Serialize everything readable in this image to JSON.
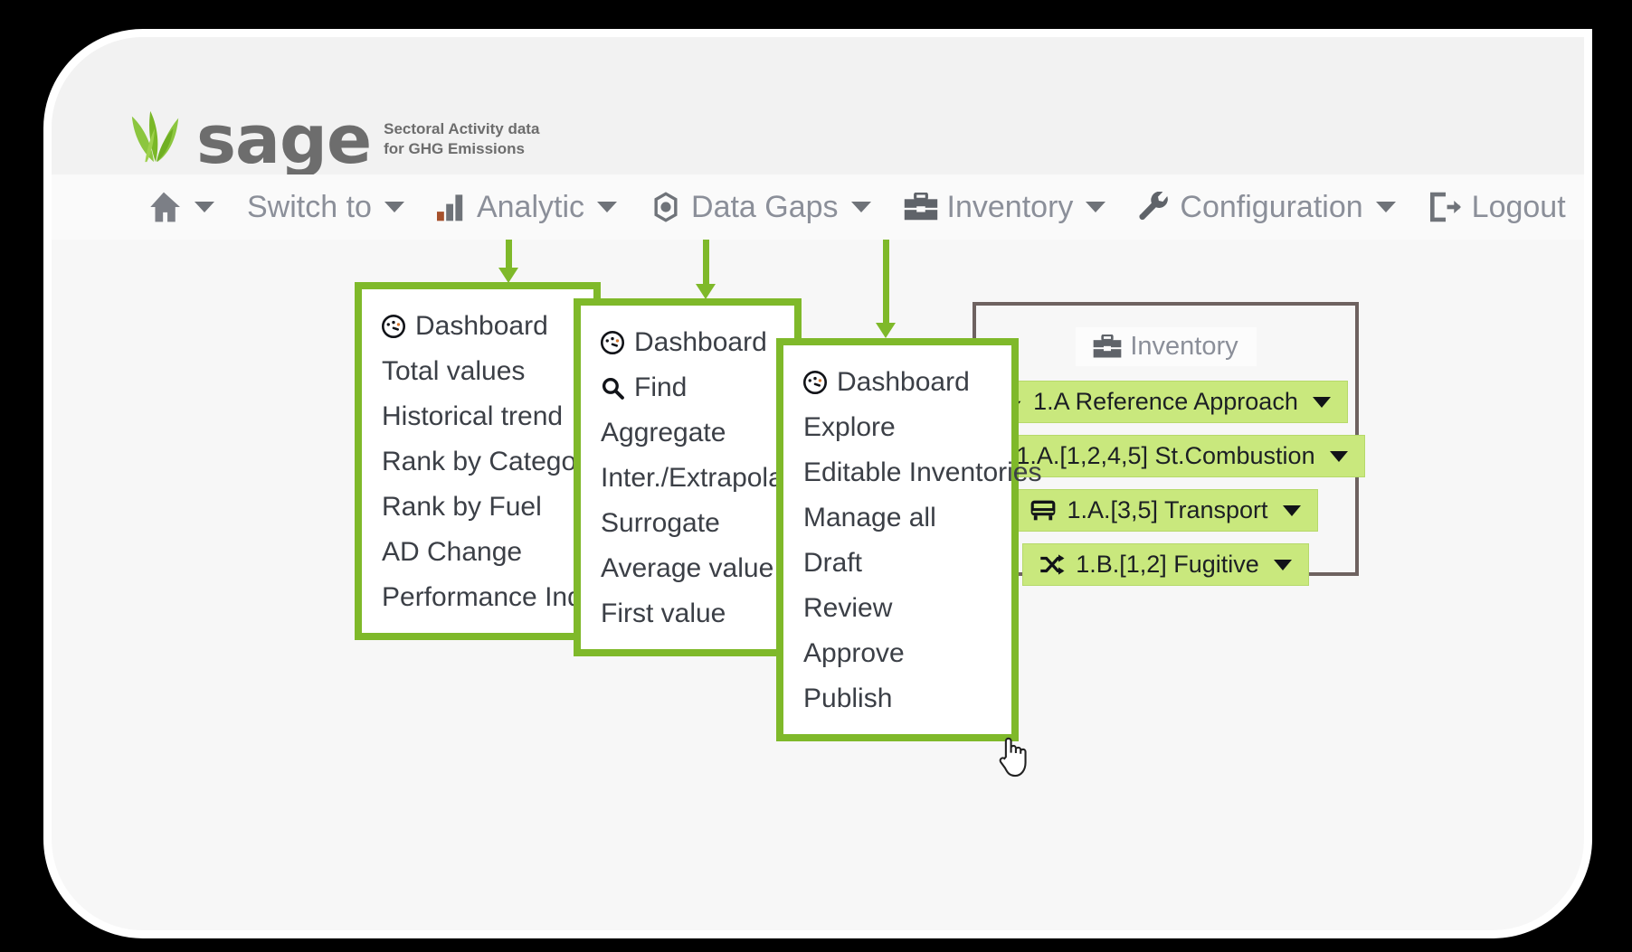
{
  "brand": {
    "wordmark": "sage",
    "tagline_line1": "Sectoral Activity data",
    "tagline_line2": "for GHG Emissions",
    "leaf_icon": "leaf-icon"
  },
  "colors": {
    "menu_border_green": "#7fb92a",
    "button_green": "#c9e87d",
    "panel_border_gray": "#6e6260",
    "nav_text_gray": "#8b8f99",
    "page_background": "#000000",
    "card_background": "#f7f7f7"
  },
  "navbar": {
    "items": [
      {
        "label": "",
        "icon": "home-icon",
        "caret": true
      },
      {
        "label": "Switch to",
        "icon": "",
        "caret": true
      },
      {
        "label": "Analytic",
        "icon": "bar-chart-icon",
        "caret": true
      },
      {
        "label": "Data Gaps",
        "icon": "eye-icon",
        "caret": true
      },
      {
        "label": "Inventory",
        "icon": "briefcase-icon",
        "caret": true
      },
      {
        "label": "Configuration",
        "icon": "wrench-icon",
        "caret": true
      },
      {
        "label": "Logout",
        "icon": "logout-icon",
        "caret": false
      }
    ]
  },
  "menus": {
    "analytic": {
      "source_nav": "Analytic",
      "items": [
        {
          "label": "Dashboard",
          "icon": "gauge-icon"
        },
        {
          "label": "Total values",
          "icon": ""
        },
        {
          "label": "Historical trend",
          "icon": ""
        },
        {
          "label": "Rank by Category",
          "icon": ""
        },
        {
          "label": "Rank by Fuel",
          "icon": ""
        },
        {
          "label": "AD Change",
          "icon": ""
        },
        {
          "label": "Performance Indicator",
          "icon": ""
        }
      ]
    },
    "data_gaps": {
      "source_nav": "Data Gaps",
      "items": [
        {
          "label": "Dashboard",
          "icon": "gauge-icon"
        },
        {
          "label": "Find",
          "icon": "search-icon"
        },
        {
          "label": "Aggregate",
          "icon": ""
        },
        {
          "label": "Inter./Extrapolate",
          "icon": ""
        },
        {
          "label": "Surrogate",
          "icon": ""
        },
        {
          "label": "Average value",
          "icon": ""
        },
        {
          "label": "First value",
          "icon": ""
        }
      ]
    },
    "inventory": {
      "source_nav": "Inventory",
      "items": [
        {
          "label": "Dashboard",
          "icon": "gauge-icon"
        },
        {
          "label": "Explore",
          "icon": ""
        },
        {
          "label": "Editable Inventories",
          "icon": ""
        },
        {
          "label": "Manage all",
          "icon": ""
        },
        {
          "label": "Draft",
          "icon": ""
        },
        {
          "label": "Review",
          "icon": ""
        },
        {
          "label": "Approve",
          "icon": ""
        },
        {
          "label": "Publish",
          "icon": ""
        }
      ]
    }
  },
  "inventory_panel": {
    "header_label": "Inventory",
    "header_icon": "briefcase-icon",
    "buttons": [
      {
        "label": "1.A Reference Approach",
        "icon": "arrow-down-icon",
        "caret": true
      },
      {
        "label": "1.A.[1,2,4,5] St.Combustion",
        "icon": "fire-icon",
        "caret": true
      },
      {
        "label": "1.A.[3,5] Transport",
        "icon": "bus-icon",
        "caret": true
      },
      {
        "label": "1.B.[1,2] Fugitive",
        "icon": "shuffle-icon",
        "caret": true
      }
    ]
  },
  "cursor": {
    "type": "pointer-hand-cursor"
  }
}
